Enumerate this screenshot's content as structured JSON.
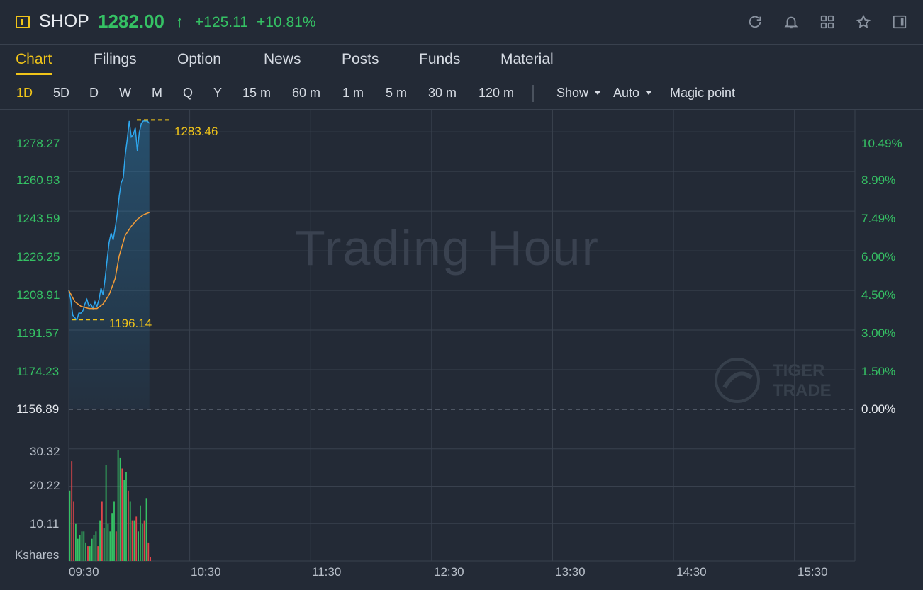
{
  "header": {
    "ticker": "SHOP",
    "price": "1282.00",
    "arrow": "↑",
    "change": "+125.11",
    "change_pct": "+10.81%",
    "icons": [
      "refresh-icon",
      "bell-icon",
      "grid-icon",
      "star-icon",
      "sidebar-icon"
    ],
    "accent_color": "#f0c419",
    "up_color": "#35c164",
    "down_color": "#e0464a"
  },
  "tabs": [
    {
      "label": "Chart",
      "active": true
    },
    {
      "label": "Filings"
    },
    {
      "label": "Option"
    },
    {
      "label": "News"
    },
    {
      "label": "Posts"
    },
    {
      "label": "Funds"
    },
    {
      "label": "Material"
    }
  ],
  "periods": [
    "1D",
    "5D",
    "D",
    "W",
    "M",
    "Q",
    "Y",
    "15 m",
    "60 m",
    "1 m",
    "5 m",
    "30 m",
    "120 m"
  ],
  "active_period": "1D",
  "dropdowns": {
    "show": "Show",
    "auto": "Auto"
  },
  "magic_point": "Magic point",
  "chart": {
    "watermark": "Trading Hour",
    "brand_line1": "TIGER",
    "brand_line2": "TRADE",
    "price_ticks": [
      "1278.27",
      "1260.93",
      "1243.59",
      "1226.25",
      "1208.91",
      "1191.57",
      "1174.23",
      "1156.89"
    ],
    "pct_ticks": [
      "10.49%",
      "8.99%",
      "7.49%",
      "6.00%",
      "4.50%",
      "3.00%",
      "1.50%",
      "0.00%"
    ],
    "volume_ticks": [
      "30.32",
      "20.22",
      "10.11"
    ],
    "volume_unit": "Kshares",
    "time_ticks": [
      "09:30",
      "10:30",
      "11:30",
      "12:30",
      "13:30",
      "14:30",
      "15:30"
    ],
    "high_label": "1283.46",
    "low_label": "1196.14"
  },
  "chart_data": {
    "type": "line",
    "ylim": [
      1156.89,
      1287.0
    ],
    "pct_range": [
      0.0,
      10.49
    ],
    "time_range": [
      "09:30",
      "16:00"
    ],
    "series": [
      {
        "name": "",
        "color": "#2ea7ee",
        "points": [
          [
            0,
            1209
          ],
          [
            1,
            1205
          ],
          [
            2,
            1198
          ],
          [
            3,
            1197
          ],
          [
            4,
            1196
          ],
          [
            5,
            1199
          ],
          [
            6,
            1199
          ],
          [
            7,
            1200
          ],
          [
            8,
            1203
          ],
          [
            9,
            1205
          ],
          [
            10,
            1202
          ],
          [
            11,
            1203
          ],
          [
            12,
            1201
          ],
          [
            13,
            1204
          ],
          [
            14,
            1202
          ],
          [
            15,
            1205
          ],
          [
            16,
            1210
          ],
          [
            17,
            1207
          ],
          [
            18,
            1214
          ],
          [
            19,
            1222
          ],
          [
            20,
            1230
          ],
          [
            21,
            1234
          ],
          [
            22,
            1231
          ],
          [
            23,
            1236
          ],
          [
            24,
            1242
          ],
          [
            25,
            1250
          ],
          [
            26,
            1256
          ],
          [
            27,
            1258
          ],
          [
            28,
            1268
          ],
          [
            29,
            1275
          ],
          [
            30,
            1283
          ],
          [
            31,
            1276
          ],
          [
            32,
            1277
          ],
          [
            33,
            1280
          ],
          [
            34,
            1270
          ],
          [
            35,
            1278
          ],
          [
            36,
            1282
          ],
          [
            37,
            1283
          ],
          [
            38,
            1283
          ],
          [
            39,
            1283
          ],
          [
            40,
            1282
          ]
        ]
      },
      {
        "name": "",
        "color": "#f29c38",
        "points": [
          [
            0,
            1209
          ],
          [
            3,
            1204
          ],
          [
            6,
            1202
          ],
          [
            10,
            1201
          ],
          [
            14,
            1201
          ],
          [
            17,
            1203
          ],
          [
            20,
            1207
          ],
          [
            23,
            1214
          ],
          [
            25,
            1224
          ],
          [
            28,
            1233
          ],
          [
            31,
            1237
          ],
          [
            34,
            1240
          ],
          [
            37,
            1242
          ],
          [
            40,
            1243
          ]
        ]
      }
    ],
    "volume": {
      "ylim": [
        0,
        32
      ],
      "bars": [
        [
          0,
          19,
          "g"
        ],
        [
          1,
          27,
          "r"
        ],
        [
          2,
          16,
          "r"
        ],
        [
          3,
          10,
          "g"
        ],
        [
          4,
          6,
          "g"
        ],
        [
          5,
          7,
          "g"
        ],
        [
          6,
          8,
          "g"
        ],
        [
          7,
          8,
          "g"
        ],
        [
          8,
          5,
          "g"
        ],
        [
          9,
          4,
          "r"
        ],
        [
          10,
          4,
          "g"
        ],
        [
          11,
          6,
          "g"
        ],
        [
          12,
          7,
          "g"
        ],
        [
          13,
          8,
          "g"
        ],
        [
          14,
          4,
          "r"
        ],
        [
          15,
          11,
          "g"
        ],
        [
          16,
          16,
          "r"
        ],
        [
          17,
          9,
          "g"
        ],
        [
          18,
          26,
          "g"
        ],
        [
          19,
          10,
          "g"
        ],
        [
          20,
          8,
          "g"
        ],
        [
          21,
          13,
          "g"
        ],
        [
          22,
          16,
          "g"
        ],
        [
          23,
          8,
          "r"
        ],
        [
          24,
          30,
          "g"
        ],
        [
          25,
          28,
          "g"
        ],
        [
          26,
          25,
          "r"
        ],
        [
          27,
          22,
          "g"
        ],
        [
          28,
          24,
          "g"
        ],
        [
          29,
          19,
          "r"
        ],
        [
          30,
          16,
          "g"
        ],
        [
          31,
          11,
          "r"
        ],
        [
          32,
          11,
          "g"
        ],
        [
          33,
          12,
          "r"
        ],
        [
          34,
          8,
          "g"
        ],
        [
          35,
          15,
          "g"
        ],
        [
          36,
          10,
          "g"
        ],
        [
          37,
          11,
          "r"
        ],
        [
          38,
          17,
          "g"
        ],
        [
          39,
          5,
          "r"
        ],
        [
          40,
          1,
          "r"
        ]
      ]
    }
  }
}
